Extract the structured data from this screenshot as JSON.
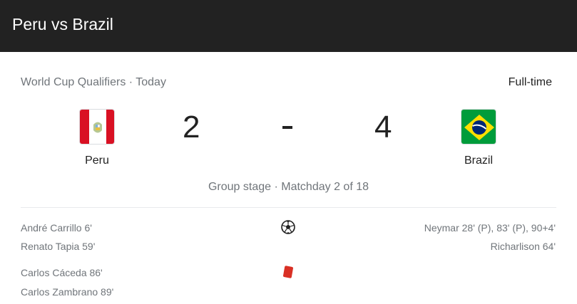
{
  "header": {
    "title": "Peru vs Brazil"
  },
  "match": {
    "competition": "World Cup Qualifiers · Today",
    "status": "Full-time",
    "home": {
      "name": "Peru",
      "score": "2",
      "flag_icon": "peru-flag-icon"
    },
    "away": {
      "name": "Brazil",
      "score": "4",
      "flag_icon": "brazil-flag-icon"
    },
    "stage": "Group stage · Matchday 2 of 18"
  },
  "goals": {
    "icon": "soccer-ball-icon",
    "home": [
      "André Carrillo 6'",
      "Renato Tapia 59'"
    ],
    "away": [
      "Neymar 28' (P), 83' (P), 90+4'",
      "Richarlison 64'"
    ]
  },
  "red_cards": {
    "icon": "red-card-icon",
    "home": [
      "Carlos Cáceda 86'",
      "Carlos Zambrano 89'"
    ]
  },
  "colors": {
    "header_bg": "#222222",
    "muted_text": "#70757a",
    "red_card": "#d93025"
  }
}
